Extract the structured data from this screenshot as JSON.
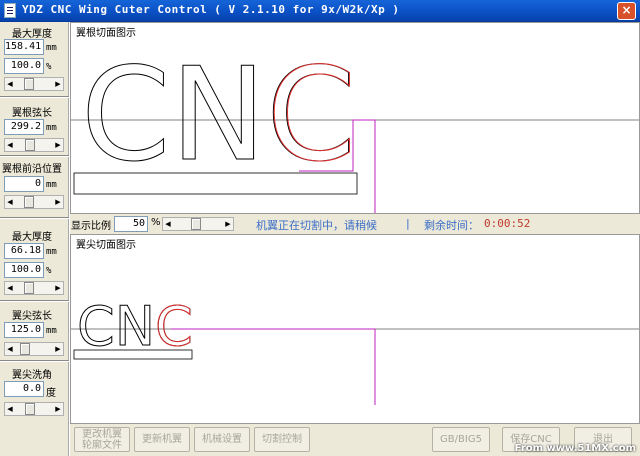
{
  "window": {
    "title": "YDZ CNC Wing Cuter Control ( V 2.1.10 for 9x/W2k/Xp )",
    "close_label": "×"
  },
  "root_section": {
    "max_thickness_label": "最大厚度",
    "max_thickness_value": "158.41",
    "max_thickness_unit": "mm",
    "percent_value": "100.0",
    "percent_unit": "%",
    "chord_label": "翼根弦长",
    "chord_value": "299.2",
    "chord_unit": "mm",
    "leading_edge_label": "翼根前沿位置",
    "leading_edge_value": "0",
    "leading_edge_unit": "mm"
  },
  "tip_section": {
    "max_thickness_label": "最大厚度",
    "max_thickness_value": "66.18",
    "max_thickness_unit": "mm",
    "percent_value": "100.0",
    "percent_unit": "%",
    "chord_label": "翼尖弦长",
    "chord_value": "125.0",
    "chord_unit": "mm",
    "sweep_label": "翼尖洗角",
    "sweep_value": "0.0",
    "sweep_unit": "度"
  },
  "root_panel": {
    "title": "翼根切面图示",
    "text": "CNC"
  },
  "tip_panel": {
    "title": "翼尖切面图示",
    "text": "CNC"
  },
  "display": {
    "scale_label": "显示比例",
    "scale_value": "50",
    "scale_unit": "%"
  },
  "status": {
    "message": "机翼正在切割中，请稍候",
    "separator": "|",
    "remaining_label": "剩余时间：",
    "remaining_time": "0:00:52"
  },
  "buttons": {
    "change_line1": "更改机翼",
    "change_line2": "轮廓文件",
    "update": "更新机翼",
    "machine_settings": "机械设置",
    "cut_control": "切割控制",
    "encoding": "GB/BIG5",
    "save": "保存CNC",
    "exit": "退出"
  },
  "watermark": "From www.51MX.com",
  "colors": {
    "title_bar": "#0a4fc4",
    "status_text": "#3c6ec8",
    "time_text": "#c0392b",
    "cut_path": "#e03030",
    "wire_path": "#c020c0"
  }
}
